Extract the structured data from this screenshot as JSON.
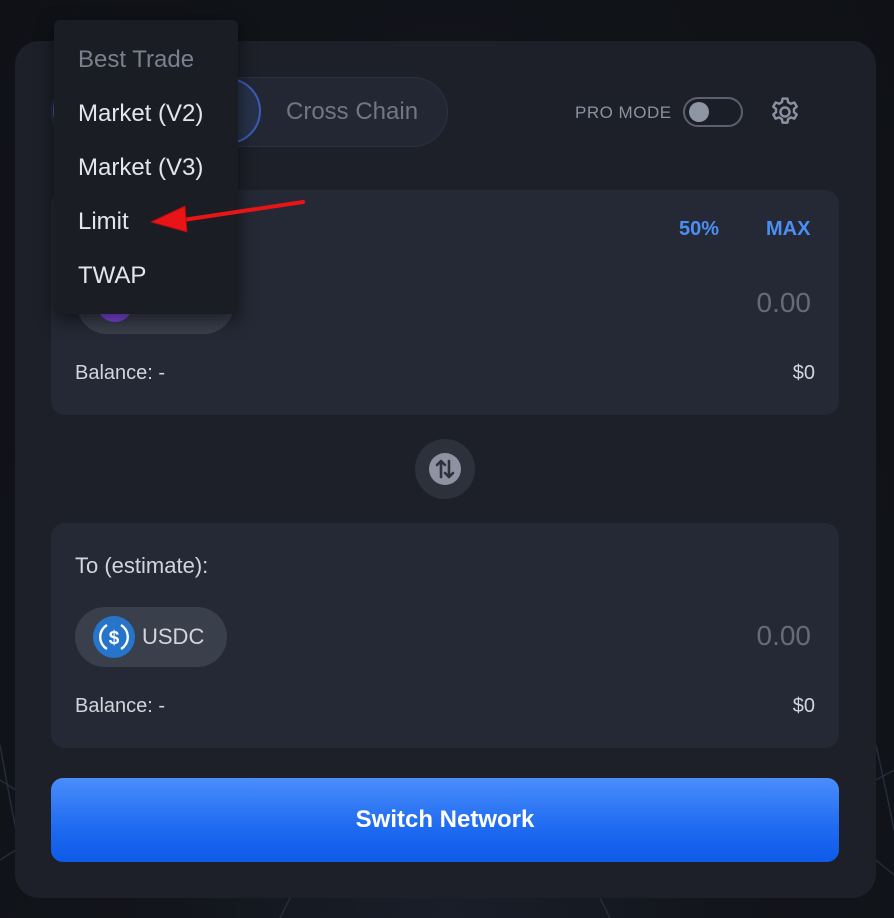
{
  "dropdown": {
    "header": "Best Trade",
    "items": [
      "Market (V2)",
      "Market (V3)",
      "Limit",
      "TWAP"
    ]
  },
  "tabs": {
    "cross_chain": "Cross Chain"
  },
  "header": {
    "pro_mode_label": "PRO MODE",
    "pro_mode_on": false
  },
  "from_panel": {
    "pct_50": "50%",
    "max": "MAX",
    "amount_placeholder": "0.00",
    "balance": "Balance: -",
    "usd_value": "$0"
  },
  "to_panel": {
    "label": "To (estimate):",
    "token": "USDC",
    "amount_placeholder": "0.00",
    "balance": "Balance: -",
    "usd_value": "$0"
  },
  "action_button": "Switch Network",
  "colors": {
    "accent_blue": "#4d8ef5",
    "button_blue": "#1e6af0",
    "arrow_red": "#e81416",
    "usdc_blue": "#2775ca",
    "token_purple": "#8247e5"
  }
}
